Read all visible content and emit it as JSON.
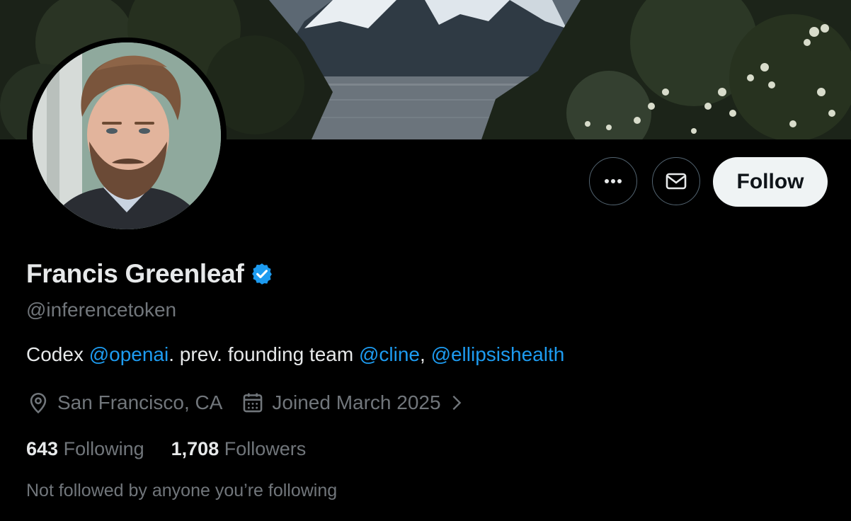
{
  "profile": {
    "name": "Francis Greenleaf",
    "handle": "@inferencetoken",
    "verified": true,
    "bio": {
      "prefix": "Codex ",
      "mention1": "@openai",
      "middle": ". prev. founding team ",
      "mention2": "@cline",
      "comma": ", ",
      "mention3": "@ellipsishealth"
    },
    "location": "San Francisco, CA",
    "joined": "Joined March 2025",
    "following_count": "643",
    "following_label": "Following",
    "followers_count": "1,708",
    "followers_label": "Followers",
    "followed_by_note": "Not followed by anyone you’re following"
  },
  "actions": {
    "more_icon": "more-icon",
    "message_icon": "envelope-icon",
    "follow_label": "Follow"
  },
  "colors": {
    "background": "#000000",
    "accent": "#1d9bf0",
    "secondary_text": "#71767b",
    "primary_text": "#e7e9ea",
    "follow_button_bg": "#eff3f4"
  }
}
